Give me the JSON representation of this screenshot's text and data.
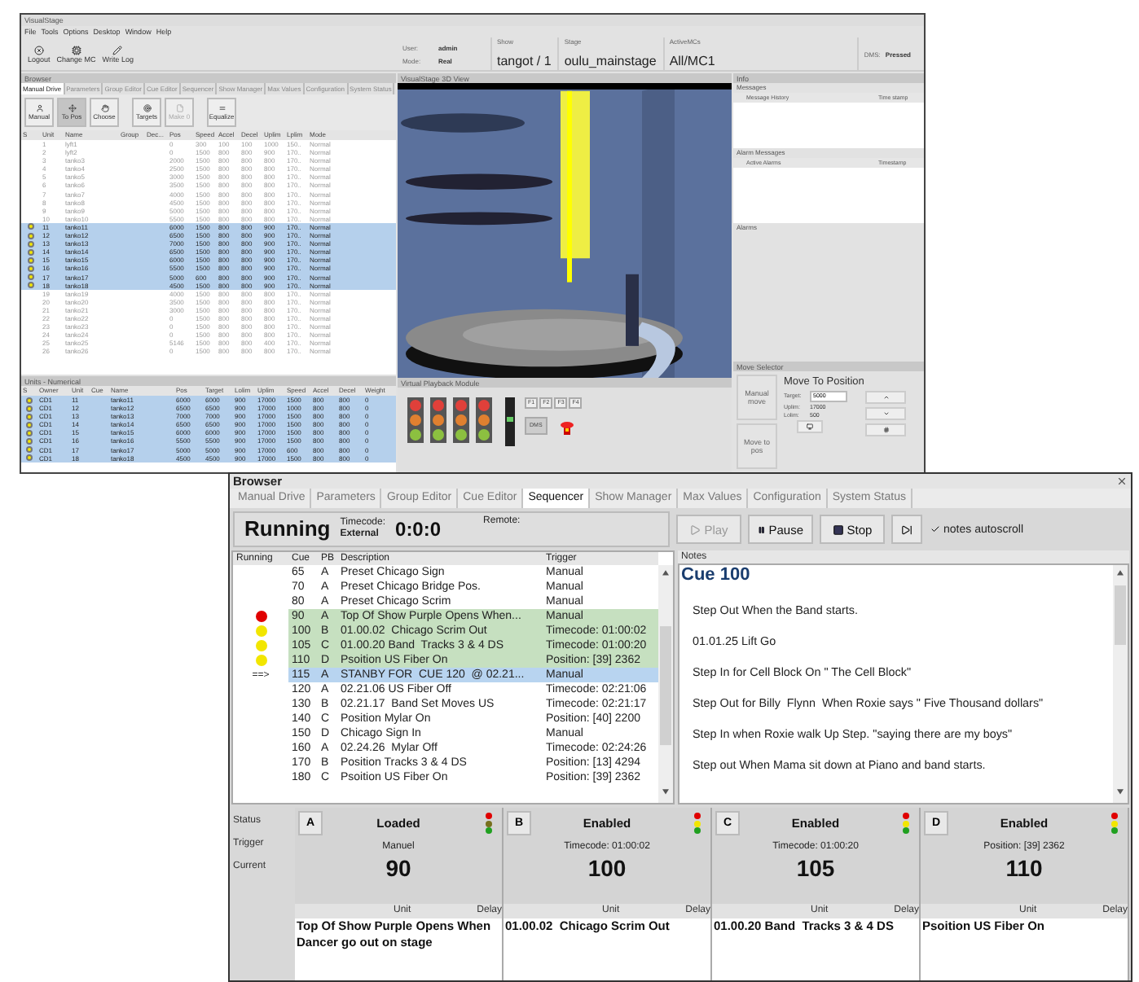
{
  "background_window": {
    "title": "VisualStage",
    "menu": [
      "File",
      "Tools",
      "Options",
      "Desktop",
      "Window",
      "Help"
    ],
    "toolbar": [
      {
        "label": "Logout"
      },
      {
        "label": "Change MC"
      },
      {
        "label": "Write Log"
      }
    ],
    "info_fields": [
      {
        "label": "User:",
        "value": "admin"
      },
      {
        "label": "Mode:",
        "value": "Real"
      }
    ],
    "show": {
      "label": "Show",
      "value": "tangot / 1"
    },
    "stage": {
      "label": "Stage",
      "value": "oulu_mainstage"
    },
    "active_mcs": {
      "label": "ActiveMCs",
      "value": "All/MC1"
    },
    "dms": {
      "label": "DMS:",
      "value": "Pressed"
    },
    "browser": {
      "title": "Browser",
      "tabs": [
        {
          "label": "Manual Drive",
          "selected": true
        },
        {
          "label": "Parameters",
          "selected": false
        },
        {
          "label": "Group Editor",
          "selected": false
        },
        {
          "label": "Cue Editor",
          "selected": false
        },
        {
          "label": "Sequencer",
          "selected": false
        },
        {
          "label": "Show Manager",
          "selected": false
        },
        {
          "label": "Max Values",
          "selected": false
        },
        {
          "label": "Configuration",
          "selected": false
        },
        {
          "label": "System Status",
          "selected": false
        }
      ],
      "buttons": [
        {
          "label": "Manual",
          "pressed": false,
          "disabled": false
        },
        {
          "label": "To Pos",
          "pressed": true,
          "disabled": false
        },
        {
          "label": "Choose",
          "pressed": false,
          "disabled": false
        },
        {
          "label": "Targets",
          "pressed": false,
          "disabled": false
        },
        {
          "label": "Make 0",
          "pressed": false,
          "disabled": true
        },
        {
          "label": "Equalize",
          "pressed": false,
          "disabled": false
        }
      ],
      "columns": [
        {
          "label": "S",
          "kind": "dot"
        },
        {
          "label": "Unit",
          "kind": "text"
        },
        {
          "label": "Name",
          "kind": "text"
        },
        {
          "label": "Group",
          "kind": "text"
        },
        {
          "label": "Dec...",
          "kind": "text"
        },
        {
          "label": "Pos",
          "kind": "text"
        },
        {
          "label": "Speed",
          "kind": "text"
        },
        {
          "label": "Accel",
          "kind": "text"
        },
        {
          "label": "Decel",
          "kind": "text"
        },
        {
          "label": "Uplim",
          "kind": "text"
        },
        {
          "label": "Lplim",
          "kind": "text"
        },
        {
          "label": "Mode",
          "kind": "text"
        }
      ],
      "rows": [
        {
          "cells": [
            "",
            "1",
            "lyft1",
            "",
            "",
            "0",
            "300",
            "100",
            "100",
            "1000",
            "150..",
            "Normal"
          ],
          "selected": false
        },
        {
          "cells": [
            "",
            "2",
            "lyft2",
            "",
            "",
            "0",
            "1500",
            "800",
            "800",
            "900",
            "170..",
            "Normal"
          ],
          "selected": false
        },
        {
          "cells": [
            "",
            "3",
            "tanko3",
            "",
            "",
            "2000",
            "1500",
            "800",
            "800",
            "800",
            "170..",
            "Normal"
          ],
          "selected": false
        },
        {
          "cells": [
            "",
            "4",
            "tanko4",
            "",
            "",
            "2500",
            "1500",
            "800",
            "800",
            "800",
            "170..",
            "Normal"
          ],
          "selected": false
        },
        {
          "cells": [
            "",
            "5",
            "tanko5",
            "",
            "",
            "3000",
            "1500",
            "800",
            "800",
            "800",
            "170..",
            "Normal"
          ],
          "selected": false
        },
        {
          "cells": [
            "",
            "6",
            "tanko6",
            "",
            "",
            "3500",
            "1500",
            "800",
            "800",
            "800",
            "170..",
            "Normal"
          ],
          "selected": false
        },
        {
          "cells": [
            "",
            "7",
            "tanko7",
            "",
            "",
            "4000",
            "1500",
            "800",
            "800",
            "800",
            "170..",
            "Normal"
          ],
          "selected": false
        },
        {
          "cells": [
            "",
            "8",
            "tanko8",
            "",
            "",
            "4500",
            "1500",
            "800",
            "800",
            "800",
            "170..",
            "Normal"
          ],
          "selected": false
        },
        {
          "cells": [
            "",
            "9",
            "tanko9",
            "",
            "",
            "5000",
            "1500",
            "800",
            "800",
            "800",
            "170..",
            "Normal"
          ],
          "selected": false
        },
        {
          "cells": [
            "",
            "10",
            "tanko10",
            "",
            "",
            "5500",
            "1500",
            "800",
            "800",
            "800",
            "170..",
            "Normal"
          ],
          "selected": false
        },
        {
          "cells": [
            "",
            "11",
            "tanko11",
            "",
            "",
            "6000",
            "1500",
            "800",
            "800",
            "900",
            "170..",
            "Normal"
          ],
          "selected": true
        },
        {
          "cells": [
            "",
            "12",
            "tanko12",
            "",
            "",
            "6500",
            "1500",
            "800",
            "800",
            "900",
            "170..",
            "Normal"
          ],
          "selected": true
        },
        {
          "cells": [
            "",
            "13",
            "tanko13",
            "",
            "",
            "7000",
            "1500",
            "800",
            "800",
            "900",
            "170..",
            "Normal"
          ],
          "selected": true
        },
        {
          "cells": [
            "",
            "14",
            "tanko14",
            "",
            "",
            "6500",
            "1500",
            "800",
            "800",
            "900",
            "170..",
            "Normal"
          ],
          "selected": true
        },
        {
          "cells": [
            "",
            "15",
            "tanko15",
            "",
            "",
            "6000",
            "1500",
            "800",
            "800",
            "900",
            "170..",
            "Normal"
          ],
          "selected": true
        },
        {
          "cells": [
            "",
            "16",
            "tanko16",
            "",
            "",
            "5500",
            "1500",
            "800",
            "800",
            "900",
            "170..",
            "Normal"
          ],
          "selected": true
        },
        {
          "cells": [
            "",
            "17",
            "tanko17",
            "",
            "",
            "5000",
            "600",
            "800",
            "800",
            "900",
            "170..",
            "Normal"
          ],
          "selected": true
        },
        {
          "cells": [
            "",
            "18",
            "tanko18",
            "",
            "",
            "4500",
            "1500",
            "800",
            "800",
            "900",
            "170..",
            "Normal"
          ],
          "selected": true
        },
        {
          "cells": [
            "",
            "19",
            "tanko19",
            "",
            "",
            "4000",
            "1500",
            "800",
            "800",
            "800",
            "170..",
            "Normal"
          ],
          "selected": false
        },
        {
          "cells": [
            "",
            "20",
            "tanko20",
            "",
            "",
            "3500",
            "1500",
            "800",
            "800",
            "800",
            "170..",
            "Normal"
          ],
          "selected": false
        },
        {
          "cells": [
            "",
            "21",
            "tanko21",
            "",
            "",
            "3000",
            "1500",
            "800",
            "800",
            "800",
            "170..",
            "Normal"
          ],
          "selected": false
        },
        {
          "cells": [
            "",
            "22",
            "tanko22",
            "",
            "",
            "0",
            "1500",
            "800",
            "800",
            "800",
            "170..",
            "Normal"
          ],
          "selected": false
        },
        {
          "cells": [
            "",
            "23",
            "tanko23",
            "",
            "",
            "0",
            "1500",
            "800",
            "800",
            "800",
            "170..",
            "Normal"
          ],
          "selected": false
        },
        {
          "cells": [
            "",
            "24",
            "tanko24",
            "",
            "",
            "0",
            "1500",
            "800",
            "800",
            "800",
            "170..",
            "Normal"
          ],
          "selected": false
        },
        {
          "cells": [
            "",
            "25",
            "tanko25",
            "",
            "",
            "5146",
            "1500",
            "800",
            "800",
            "400",
            "170..",
            "Normal"
          ],
          "selected": false
        },
        {
          "cells": [
            "",
            "26",
            "tanko26",
            "",
            "",
            "0",
            "1500",
            "800",
            "800",
            "800",
            "170..",
            "Normal"
          ],
          "selected": false
        }
      ]
    },
    "units": {
      "title": "Units - Numerical",
      "columns": [
        {
          "label": "S",
          "kind": "dot"
        },
        {
          "label": "Owner",
          "kind": "text"
        },
        {
          "label": "Unit",
          "kind": "text"
        },
        {
          "label": "Cue",
          "kind": "text"
        },
        {
          "label": "Name",
          "kind": "text"
        },
        {
          "label": "Pos",
          "kind": "text"
        },
        {
          "label": "Target",
          "kind": "text"
        },
        {
          "label": "Lolim",
          "kind": "text"
        },
        {
          "label": "Uplim",
          "kind": "text"
        },
        {
          "label": "Speed",
          "kind": "text"
        },
        {
          "label": "Accel",
          "kind": "text"
        },
        {
          "label": "Decel",
          "kind": "text"
        },
        {
          "label": "Weight",
          "kind": "text"
        }
      ],
      "rows": [
        {
          "cells": [
            "",
            "CD1",
            "11",
            "",
            "tanko11",
            "6000",
            "6000",
            "900",
            "17000",
            "1500",
            "800",
            "800",
            "0"
          ],
          "selected": true
        },
        {
          "cells": [
            "",
            "CD1",
            "12",
            "",
            "tanko12",
            "6500",
            "6500",
            "900",
            "17000",
            "1000",
            "800",
            "800",
            "0"
          ],
          "selected": true
        },
        {
          "cells": [
            "",
            "CD1",
            "13",
            "",
            "tanko13",
            "7000",
            "7000",
            "900",
            "17000",
            "1500",
            "800",
            "800",
            "0"
          ],
          "selected": true
        },
        {
          "cells": [
            "",
            "CD1",
            "14",
            "",
            "tanko14",
            "6500",
            "6500",
            "900",
            "17000",
            "1500",
            "800",
            "800",
            "0"
          ],
          "selected": true
        },
        {
          "cells": [
            "",
            "CD1",
            "15",
            "",
            "tanko15",
            "6000",
            "6000",
            "900",
            "17000",
            "1500",
            "800",
            "800",
            "0"
          ],
          "selected": true
        },
        {
          "cells": [
            "",
            "CD1",
            "16",
            "",
            "tanko16",
            "5500",
            "5500",
            "900",
            "17000",
            "1500",
            "800",
            "800",
            "0"
          ],
          "selected": true
        },
        {
          "cells": [
            "",
            "CD1",
            "17",
            "",
            "tanko17",
            "5000",
            "5000",
            "900",
            "17000",
            "600",
            "800",
            "800",
            "0"
          ],
          "selected": true
        },
        {
          "cells": [
            "",
            "CD1",
            "18",
            "",
            "tanko18",
            "4500",
            "4500",
            "900",
            "17000",
            "1500",
            "800",
            "800",
            "0"
          ],
          "selected": true
        }
      ]
    },
    "view_3d": {
      "title": "VisualStage 3D View"
    },
    "playback_module": {
      "title": "Virtual Playback Module",
      "function_keys": [
        "F1",
        "F2",
        "F3",
        "F4"
      ],
      "dms_button": "DMS"
    },
    "info": {
      "title": "Info",
      "messages_label": "Messages",
      "message_columns": [
        "Message History",
        "Time stamp"
      ],
      "alarm_label": "Alarm Messages",
      "alarm_columns": [
        "Active Alarms",
        "Timestamp"
      ],
      "alarms_label": "Alarms"
    },
    "move_selector": {
      "title": "Move Selector",
      "modes": [
        "Manual move",
        "Move to pos"
      ],
      "heading": "Move To Position",
      "target": {
        "label": "Target:",
        "value": "5000"
      },
      "uplim": {
        "label": "Uplim:",
        "value": "17000"
      },
      "lolim": {
        "label": "Lolim:",
        "value": "500"
      }
    }
  },
  "browser_window": {
    "title": "Browser",
    "tabs": [
      {
        "label": "Manual Drive",
        "selected": false
      },
      {
        "label": "Parameters",
        "selected": false
      },
      {
        "label": "Group Editor",
        "selected": false
      },
      {
        "label": "Cue Editor",
        "selected": false
      },
      {
        "label": "Sequencer",
        "selected": true
      },
      {
        "label": "Show Manager",
        "selected": false
      },
      {
        "label": "Max Values",
        "selected": false
      },
      {
        "label": "Configuration",
        "selected": false
      },
      {
        "label": "System Status",
        "selected": false
      }
    ],
    "status": "Running",
    "timecode_label": "Timecode:",
    "timecode_source": "External",
    "timecode": "0:0:0",
    "remote_label": "Remote:",
    "buttons": [
      {
        "label": "Play",
        "kind": "play",
        "disabled": true
      },
      {
        "label": "Pause",
        "kind": "pause",
        "disabled": false
      },
      {
        "label": "Stop",
        "kind": "stop",
        "disabled": false
      },
      {
        "kind": "skip",
        "disabled": false
      }
    ],
    "autoscroll": {
      "label": "notes autoscroll",
      "checked": true
    },
    "cue_table": {
      "columns": [
        "Running",
        "Cue",
        "PB",
        "Description",
        "Trigger"
      ],
      "rows": [
        {
          "cue": "65",
          "pb": "A",
          "description": "Preset Chicago Sign",
          "trigger": "Manual",
          "loaded": false,
          "selected": false
        },
        {
          "cue": "70",
          "pb": "A",
          "description": "Preset Chicago Bridge Pos.",
          "trigger": "Manual",
          "loaded": false,
          "selected": false
        },
        {
          "cue": "80",
          "pb": "A",
          "description": "Preset Chicago Scrim",
          "trigger": "Manual",
          "loaded": false,
          "selected": false
        },
        {
          "cue": "90",
          "pb": "A",
          "description": "Top Of Show Purple Opens When...",
          "trigger": "Manual",
          "color": "#e00000",
          "loaded": true,
          "selected": false
        },
        {
          "cue": "100",
          "pb": "B",
          "description": "01.00.02  Chicago Scrim Out",
          "trigger": "Timecode: 01:00:02",
          "color": "#f2e600",
          "loaded": true,
          "selected": false
        },
        {
          "cue": "105",
          "pb": "C",
          "description": "01.00.20 Band  Tracks 3 & 4 DS",
          "trigger": "Timecode: 01:00:20",
          "color": "#f2e600",
          "loaded": true,
          "selected": false
        },
        {
          "cue": "110",
          "pb": "D",
          "description": "Psoition US Fiber On",
          "trigger": "Position: [39] 2362",
          "color": "#f2e600",
          "loaded": true,
          "selected": false
        },
        {
          "cue": "115",
          "pb": "A",
          "description": "STANBY FOR  CUE 120  @ 02.21...",
          "trigger": "Manual",
          "marker": "==>",
          "loaded": false,
          "selected": true
        },
        {
          "cue": "120",
          "pb": "A",
          "description": "02.21.06 US Fiber Off",
          "trigger": "Timecode: 02:21:06",
          "loaded": false,
          "selected": false
        },
        {
          "cue": "130",
          "pb": "B",
          "description": "02.21.17  Band Set Moves US",
          "trigger": "Timecode: 02:21:17",
          "loaded": false,
          "selected": false
        },
        {
          "cue": "140",
          "pb": "C",
          "description": "Position Mylar On",
          "trigger": "Position: [40] 2200",
          "loaded": false,
          "selected": false
        },
        {
          "cue": "150",
          "pb": "D",
          "description": "Chicago Sign In",
          "trigger": "Manual",
          "loaded": false,
          "selected": false
        },
        {
          "cue": "160",
          "pb": "A",
          "description": "02.24.26  Mylar Off",
          "trigger": "Timecode: 02:24:26",
          "loaded": false,
          "selected": false
        },
        {
          "cue": "170",
          "pb": "B",
          "description": "Position Tracks 3 & 4 DS",
          "trigger": "Position: [13] 4294",
          "loaded": false,
          "selected": false
        },
        {
          "cue": "180",
          "pb": "C",
          "description": "Psoition US Fiber On",
          "trigger": "Position: [39] 2362",
          "loaded": false,
          "selected": false
        }
      ]
    },
    "notes": {
      "header": "Notes",
      "title": "Cue 100",
      "lines": [
        "Step Out When the Band starts.",
        "01.01.25 Lift Go",
        "Step In for Cell Block On \" The Cell Block\"",
        "Step Out for Billy  Flynn  When Roxie says \" Five Thousand dollars\"",
        "Step In when Roxie walk Up Step. \"saying there are my boys\"",
        "Step out When Mama sit down at Piano and band starts."
      ]
    },
    "row_labels": [
      "Status",
      "Trigger",
      "Current"
    ],
    "playbacks": [
      {
        "letter": "A",
        "status": "Loaded",
        "trigger": "Manuel",
        "current": "90",
        "unit_label": "Unit",
        "delay_label": "Delay",
        "description": "Top Of Show Purple Opens When Dancer go out on stage",
        "lights": {
          "red": true,
          "yellow": false,
          "green": true
        }
      },
      {
        "letter": "B",
        "status": "Enabled",
        "trigger": "Timecode: 01:00:02",
        "current": "100",
        "unit_label": "Unit",
        "delay_label": "Delay",
        "description": "01.00.02  Chicago Scrim Out",
        "lights": {
          "red": true,
          "yellow": true,
          "green": true
        }
      },
      {
        "letter": "C",
        "status": "Enabled",
        "trigger": "Timecode: 01:00:20",
        "current": "105",
        "unit_label": "Unit",
        "delay_label": "Delay",
        "description": "01.00.20 Band  Tracks 3 & 4 DS",
        "lights": {
          "red": true,
          "yellow": true,
          "green": true
        }
      },
      {
        "letter": "D",
        "status": "Enabled",
        "trigger": "Position: [39] 2362",
        "current": "110",
        "unit_label": "Unit",
        "delay_label": "Delay",
        "description": "Psoition US Fiber On",
        "lights": {
          "red": true,
          "yellow": true,
          "green": true
        }
      }
    ]
  }
}
